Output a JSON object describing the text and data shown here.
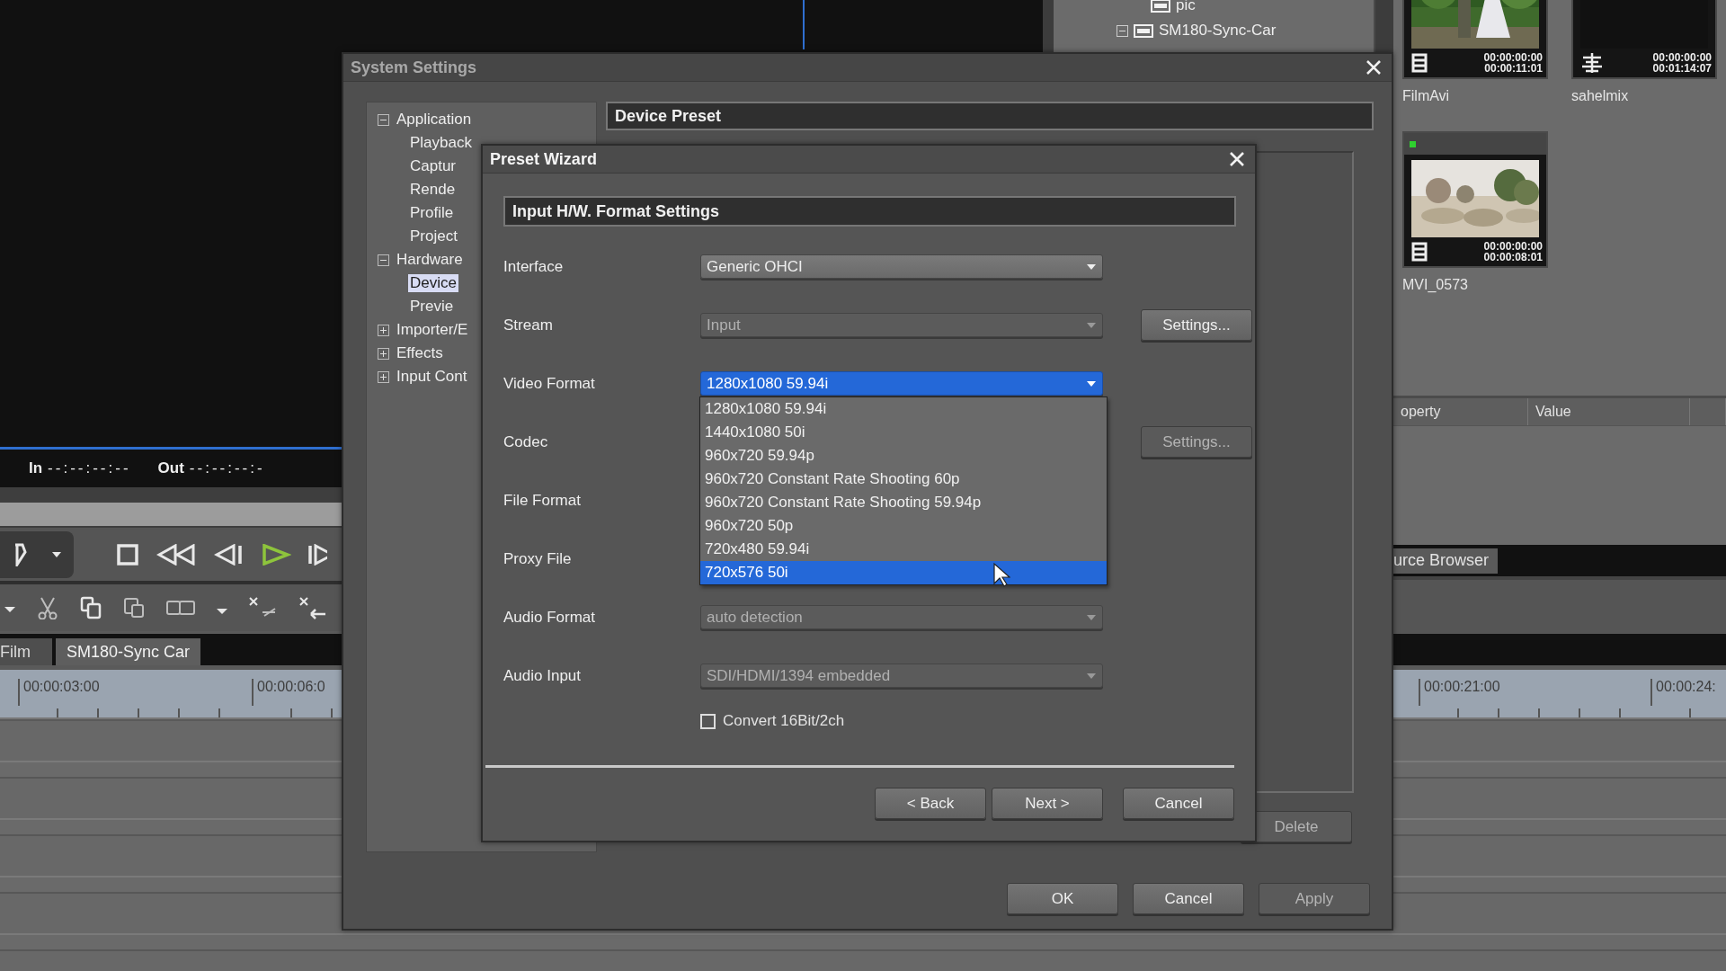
{
  "app": {
    "preview": {
      "in_label": "In",
      "in_time": "--:--:--:--",
      "out_label": "Out",
      "out_time": "--:--:--:-"
    },
    "bin_tree": [
      {
        "label": "pic",
        "kind": "leaf"
      },
      {
        "label": "SM180-Sync-Car",
        "kind": "folder",
        "expanded": true
      }
    ],
    "clips": [
      {
        "name": "FilmAvi",
        "kind": "video",
        "timecode_in": "00:00:00:00",
        "timecode_out": "00:00:11:01"
      },
      {
        "name": "sahelmix",
        "kind": "audio",
        "timecode_in": "00:00:00:00",
        "timecode_out": "00:01:14:07"
      },
      {
        "name": "MVI_0573",
        "kind": "video",
        "timecode_in": "00:00:00:00",
        "timecode_out": "00:00:08:01"
      }
    ],
    "property_table": {
      "columns": [
        "operty",
        "Value"
      ]
    },
    "source_browser_tab": "urce Browser",
    "timeline_tabs": [
      {
        "label": "Film",
        "selected": false
      },
      {
        "label": "SM180-Sync Car",
        "selected": true
      }
    ],
    "ruler": {
      "left_labels": [
        "00:00:03:00",
        "00:00:06:0"
      ],
      "right_labels": [
        "00:00:21:00",
        "00:00:24:"
      ]
    }
  },
  "system_settings": {
    "title": "System Settings",
    "tree": [
      {
        "label": "Application",
        "expanded": true,
        "selected": false,
        "children": [
          {
            "label": "Playback",
            "selected": false
          },
          {
            "label": "Captur",
            "selected": false
          },
          {
            "label": "Rende",
            "selected": false
          },
          {
            "label": "Profile",
            "selected": false
          },
          {
            "label": "Project",
            "selected": false
          }
        ]
      },
      {
        "label": "Hardware",
        "expanded": true,
        "selected": false,
        "children": [
          {
            "label": "Device",
            "selected": true
          },
          {
            "label": "Previe",
            "selected": false
          }
        ]
      },
      {
        "label": "Importer/E",
        "expanded": false,
        "selected": false
      },
      {
        "label": "Effects",
        "expanded": false,
        "selected": false
      },
      {
        "label": "Input Cont",
        "expanded": false,
        "selected": false
      }
    ],
    "section_title": "Device Preset",
    "delete_button": {
      "label": "Delete",
      "disabled": true
    },
    "buttons": [
      {
        "label": "OK",
        "disabled": false
      },
      {
        "label": "Cancel",
        "disabled": false
      },
      {
        "label": "Apply",
        "disabled": true
      }
    ]
  },
  "preset_wizard": {
    "title": "Preset Wizard",
    "section_title": "Input H/W. Format Settings",
    "rows": [
      {
        "label": "Interface",
        "kind": "dropdown",
        "value": "Generic OHCI",
        "disabled": false,
        "open": false
      },
      {
        "label": "Stream",
        "kind": "dropdown",
        "value": "Input",
        "disabled": true,
        "open": false,
        "button": {
          "label": "Settings...",
          "disabled": false
        }
      },
      {
        "label": "Video Format",
        "kind": "dropdown",
        "value": "1280x1080 59.94i",
        "disabled": false,
        "open": true
      },
      {
        "label": "Codec",
        "kind": "label",
        "button": {
          "label": "Settings...",
          "disabled": true
        }
      },
      {
        "label": "File Format",
        "kind": "label"
      },
      {
        "label": "Proxy File",
        "kind": "label"
      },
      {
        "label": "Audio Format",
        "kind": "dropdown",
        "value": "auto detection",
        "disabled": true,
        "open": false
      },
      {
        "label": "Audio Input",
        "kind": "dropdown",
        "value": "SDI/HDMI/1394 embedded",
        "disabled": true,
        "open": false
      }
    ],
    "dropdown_options": [
      {
        "label": "1280x1080 59.94i",
        "selected": false
      },
      {
        "label": "1440x1080 50i",
        "selected": false
      },
      {
        "label": "960x720 59.94p",
        "selected": false
      },
      {
        "label": "960x720 Constant Rate Shooting 60p",
        "selected": false
      },
      {
        "label": "960x720 Constant Rate Shooting 59.94p",
        "selected": false
      },
      {
        "label": "960x720 50p",
        "selected": false
      },
      {
        "label": "720x480 59.94i",
        "selected": false
      },
      {
        "label": "720x576 50i",
        "selected": true
      }
    ],
    "checkbox": {
      "label": "Convert 16Bit/2ch",
      "checked": false
    },
    "buttons": [
      {
        "label": "< Back",
        "disabled": false
      },
      {
        "label": "Next >",
        "disabled": false
      },
      {
        "label": "Cancel",
        "disabled": false
      }
    ]
  }
}
